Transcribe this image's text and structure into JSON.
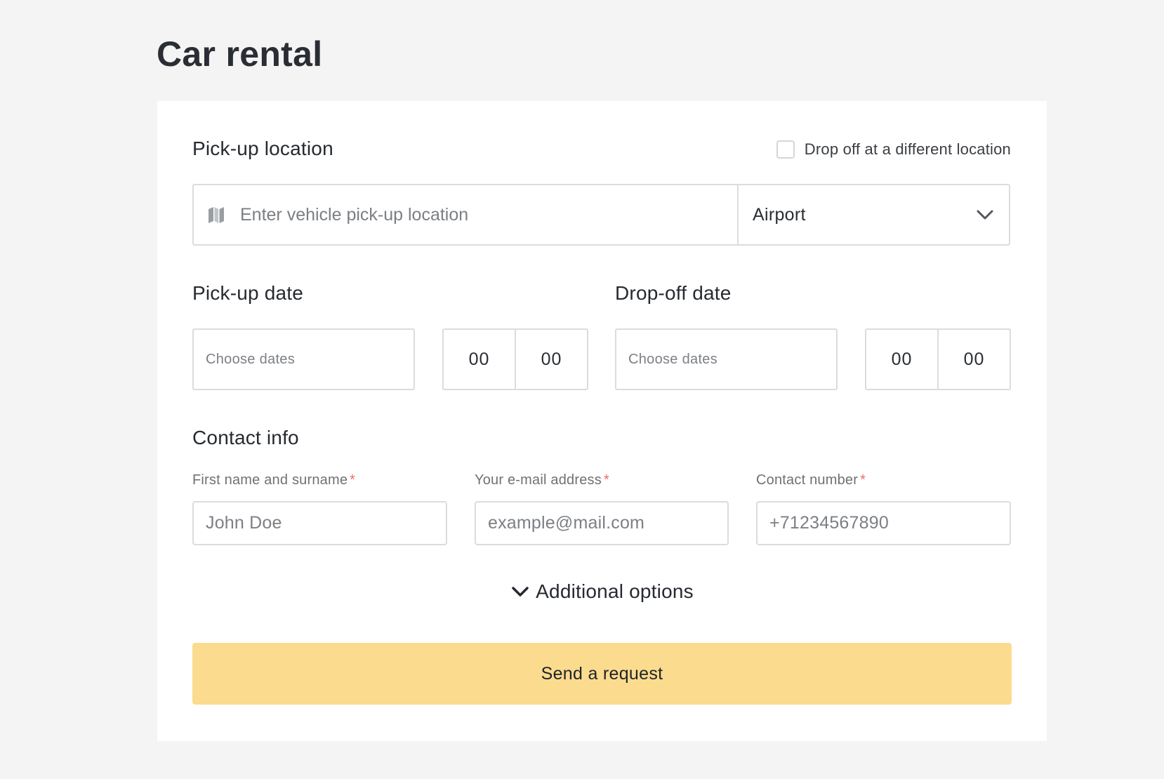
{
  "page": {
    "title": "Car rental"
  },
  "pickup_location": {
    "title": "Pick-up location",
    "different_dropoff_label": "Drop off at a different location",
    "different_dropoff_checked": false,
    "input_placeholder": "Enter vehicle pick-up location",
    "input_value": "",
    "location_type": "Airport",
    "icons": {
      "input": "map-icon",
      "select": "chevron-down-icon"
    }
  },
  "pickup_date": {
    "title": "Pick-up date",
    "date_placeholder": "Choose dates",
    "hours": "00",
    "minutes": "00"
  },
  "dropoff_date": {
    "title": "Drop-off date",
    "date_placeholder": "Choose dates",
    "hours": "00",
    "minutes": "00"
  },
  "contact_info": {
    "title": "Contact info",
    "required_mark": "*",
    "name": {
      "label": "First name and surname",
      "placeholder": "John Doe",
      "value": ""
    },
    "email": {
      "label": "Your e-mail address",
      "placeholder": "example@mail.com",
      "value": ""
    },
    "phone": {
      "label": "Contact number",
      "placeholder": "+71234567890",
      "value": ""
    }
  },
  "additional_options": {
    "label": "Additional options",
    "expanded": false
  },
  "submit": {
    "label": "Send a request"
  },
  "colors": {
    "page_background": "#f4f4f4",
    "card_background": "#ffffff",
    "border": "#dcdcdc",
    "accent_button": "#fbdb8e",
    "required": "#ec6b6b",
    "text": "#262a30",
    "placeholder": "#7c7f84"
  }
}
